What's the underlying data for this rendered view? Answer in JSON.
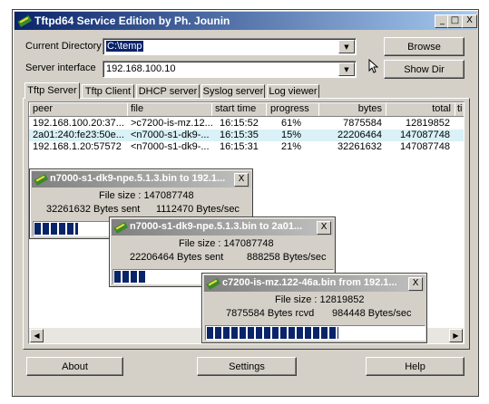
{
  "window": {
    "title": "Tftpd64 Service Edition by Ph. Jounin",
    "controls": {
      "minimize": "_",
      "maximize": "□",
      "close": "X"
    }
  },
  "form": {
    "current_directory_label": "Current Directory",
    "current_directory_value": "C:\\temp",
    "server_interface_label": "Server interface",
    "server_interface_value": "192.168.100.10",
    "browse_label": "Browse",
    "show_dir_label": "Show Dir"
  },
  "tabs": [
    "Tftp Server",
    "Tftp Client",
    "DHCP server",
    "Syslog server",
    "Log viewer"
  ],
  "table": {
    "columns": [
      "peer",
      "file",
      "start time",
      "progress",
      "bytes",
      "total",
      "ti"
    ],
    "rows": [
      [
        "192.168.100.20:37...",
        ">c7200-is-mz.12...",
        "16:15:52",
        "61%",
        "7875584",
        "12819852"
      ],
      [
        "2a01:240:fe23:50e...",
        "<n7000-s1-dk9-...",
        "16:15:35",
        "15%",
        "22206464",
        "147087748"
      ],
      [
        "192.168.1.20:57572",
        "<n7000-s1-dk9-...",
        "16:15:31",
        "21%",
        "32261632",
        "147087748"
      ]
    ]
  },
  "popups": [
    {
      "title": "n7000-s1-dk9-npe.5.1.3.bin to 192.1...",
      "file_size": "File size : 147087748",
      "bytes": "32261632 Bytes sent",
      "rate": "1112470 Bytes/sec",
      "progress": 0.21,
      "close": "X"
    },
    {
      "title": "n7000-s1-dk9-npe.5.1.3.bin to 2a01...",
      "file_size": "File size : 147087748",
      "bytes": "22206464 Bytes sent",
      "rate": "888258 Bytes/sec",
      "progress": 0.15,
      "close": "X"
    },
    {
      "title": "c7200-is-mz.122-46a.bin from 192.1...",
      "file_size": "File size : 12819852",
      "bytes": "7875584 Bytes rcvd",
      "rate": "984448 Bytes/sec",
      "progress": 0.61,
      "close": "X"
    }
  ],
  "footer": {
    "about": "About",
    "settings": "Settings",
    "help": "Help"
  },
  "scroll": {
    "left_arrow": "◀",
    "right_arrow": "▶"
  },
  "colors": {
    "title_active": "#0a246a",
    "title_inactive": "#808080",
    "selected_row": "#d9f1f7",
    "progress_fill": "#0a246a"
  }
}
